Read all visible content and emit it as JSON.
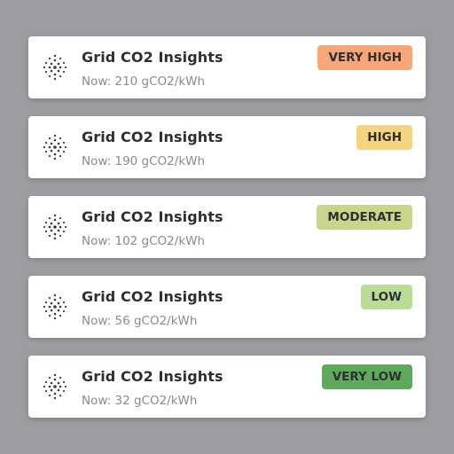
{
  "app_title": "Grid CO2 Insights",
  "icon": "dotted-globe-icon",
  "colors": {
    "background": "#9b9da0",
    "very_high": "#f6a679",
    "high": "#f4d382",
    "moderate": "#c9d58c",
    "low": "#b9dc97",
    "very_low": "#5ea95e"
  },
  "cards": [
    {
      "title": "Grid CO2 Insights",
      "subtitle": "Now: 210 gCO2/kWh",
      "level": "VERY HIGH"
    },
    {
      "title": "Grid CO2 Insights",
      "subtitle": "Now: 190 gCO2/kWh",
      "level": "HIGH"
    },
    {
      "title": "Grid CO2 Insights",
      "subtitle": "Now: 102 gCO2/kWh",
      "level": "MODERATE"
    },
    {
      "title": "Grid CO2 Insights",
      "subtitle": "Now: 56 gCO2/kWh",
      "level": "LOW"
    },
    {
      "title": "Grid CO2 Insights",
      "subtitle": "Now: 32 gCO2/kWh",
      "level": "VERY LOW"
    }
  ]
}
